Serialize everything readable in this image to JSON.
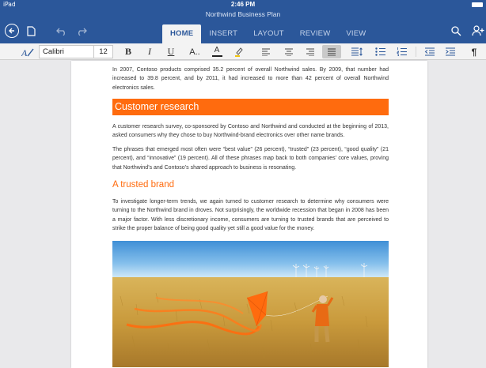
{
  "status": {
    "carrier": "iPad",
    "time": "2:46 PM"
  },
  "document": {
    "title": "Northwind Business Plan"
  },
  "tabs": [
    {
      "label": "HOME"
    },
    {
      "label": "INSERT"
    },
    {
      "label": "LAYOUT"
    },
    {
      "label": "REVIEW"
    },
    {
      "label": "VIEW"
    }
  ],
  "ribbon": {
    "font_name": "Calibri",
    "font_size": "12",
    "bold_label": "B",
    "italic_label": "I",
    "underline_label": "U",
    "text_effects_label": "A..",
    "font_color_label": "A",
    "pilcrow_label": "¶"
  },
  "content": {
    "intro": "In 2007, Contoso products comprised 35.2 percent of overall Northwind sales. By 2009, that number had increased to 39.8 percent, and by 2011, it had increased to more than 42 percent of overall Northwind electronics sales.",
    "heading1": "Customer research",
    "para1": "A customer research survey, co-sponsored by Contoso and Northwind and conducted at the beginning of 2013, asked consumers why they chose to buy Northwind-brand electronics over other name brands.",
    "para2": "The phrases that emerged most often were “best value” (26 percent), “trusted” (23 percent), “good quality” (21 percent), and “innovative” (19 percent). All of these phrases map back to both companies’ core values, proving that Northwind’s and Contoso’s shared approach to business is resonating.",
    "heading2": "A trusted brand",
    "para3": "To investigate longer-term trends, we again turned to customer research to determine why consumers were turning to the Northwind brand in droves. Not surprisingly, the worldwide recession that began in 2008 has been a major factor. With less discretionary income, consumers are turning to trusted brands that are perceived to strike the proper balance of being good quality yet still a good value for the money."
  },
  "colors": {
    "chrome": "#2b579a",
    "accent": "#ff6b0e",
    "ribbon": "#f3f3f3"
  }
}
